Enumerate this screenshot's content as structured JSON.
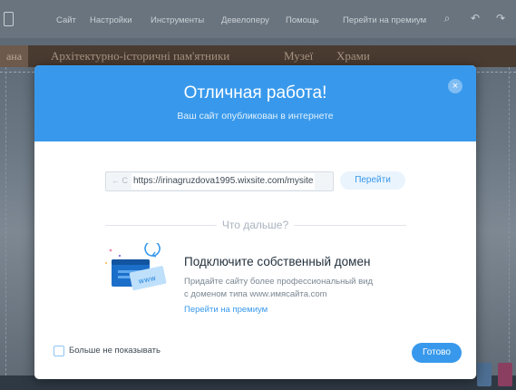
{
  "topbar": {
    "items": [
      "Сайт",
      "Настройки",
      "Инструменты",
      "Девелоперу",
      "Помощь",
      "Перейти на премиум"
    ]
  },
  "site_nav": {
    "left_fragment": "ана",
    "items": [
      "Архітектурно-історичні пам'ятники",
      "Музеї",
      "Храми"
    ]
  },
  "modal": {
    "title": "Отличная работа!",
    "subtitle": "Ваш сайт опубликован в интернете",
    "close_icon": "×",
    "url": "https://irinagruzdova1995.wixsite.com/mysite",
    "url_nav_icons": "← C",
    "go_label": "Перейти",
    "what_next": "Что дальше?",
    "domain_title": "Подключите собственный домен",
    "domain_desc_line1": "Придайте сайту более профессиональный вид",
    "domain_desc_line2": "с доменом типа www.имясайта.com",
    "upgrade_link": "Перейти на премиум",
    "illustration_label": "www",
    "dont_show_label": "Больше не показывать",
    "done_label": "Готово"
  },
  "colors": {
    "accent": "#3899ec",
    "header_bg": "#3899ec",
    "editor_bar": "#6a747e"
  }
}
